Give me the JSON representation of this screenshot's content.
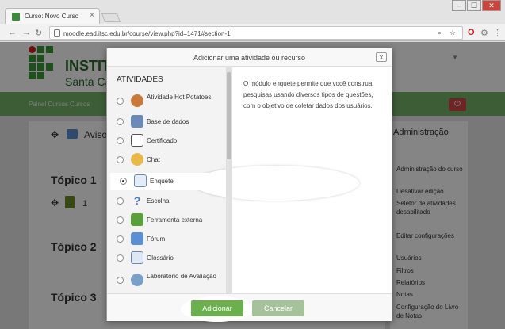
{
  "browser": {
    "tab_title": "Curso: Novo Curso",
    "tab_close": "×",
    "url": "moodle.ead.ifsc.edu.br/course/view.php?id=1471#section-1",
    "window_min": "–",
    "window_max": "☐",
    "window_close": "✕"
  },
  "header": {
    "brand_line1": "INSTITU",
    "brand_line2": "Santa Cata",
    "breadcrumb": "Painel  Cursos  Cursos"
  },
  "course": {
    "announcements": "Avisos",
    "topic1": "Tópico 1",
    "topic1_item": "1",
    "topic2": "Tópico 2",
    "topic3": "Tópico 3"
  },
  "admin": {
    "title": "Administração",
    "items": [
      "Administração do curso",
      "Desativar edição",
      "Seletor de atividades desabilitado",
      "Editar configurações",
      "Usuários",
      "Filtros",
      "Relatórios",
      "Notas",
      "Configuração do Livro de Notas"
    ]
  },
  "modal": {
    "title": "Adicionar uma atividade ou recurso",
    "close": "x",
    "section_heading": "ATIVIDADES",
    "options": [
      {
        "label": "Atividade Hot Potatoes",
        "icon": "hot-potatoes-icon",
        "selected": false
      },
      {
        "label": "Base de dados",
        "icon": "database-icon",
        "selected": false
      },
      {
        "label": "Certificado",
        "icon": "certificate-icon",
        "selected": false
      },
      {
        "label": "Chat",
        "icon": "chat-icon",
        "selected": false
      },
      {
        "label": "Enquete",
        "icon": "choice-icon",
        "selected": true
      },
      {
        "label": "Escolha",
        "icon": "question-icon",
        "selected": false
      },
      {
        "label": "Ferramenta externa",
        "icon": "puzzle-icon",
        "selected": false
      },
      {
        "label": "Fórum",
        "icon": "forum-icon",
        "selected": false
      },
      {
        "label": "Glossário",
        "icon": "glossary-icon",
        "selected": false
      },
      {
        "label": "Laboratório de Avaliação",
        "icon": "workshop-icon",
        "selected": false
      }
    ],
    "description": "O módulo enquete permite que você construa pesquisas usando diversos tipos de questões, com o objetivo de coletar dados dos usuários.",
    "add_button": "Adicionar",
    "cancel_button": "Cancelar"
  },
  "colors": {
    "green_bar": "#76b26a",
    "add_button": "#6ab04c",
    "cancel_button": "#a5c29a",
    "logout": "#cf4545"
  }
}
